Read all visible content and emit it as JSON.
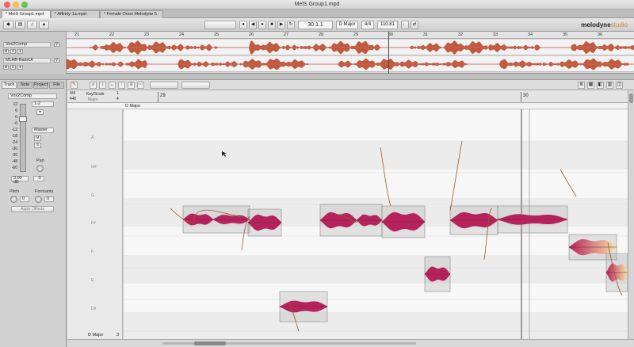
{
  "window": {
    "title": "MelS Group1.mpd",
    "controls": {
      "close_color": "#ed6a5e",
      "minimize_color": "#f5bf4f",
      "zoom_color": "#62c554"
    }
  },
  "tabs": [
    {
      "label": "* MelS Group1.mpd",
      "active": true
    },
    {
      "label": "* Affinity-1a.mpd",
      "active": false
    },
    {
      "label": "* Female Oooo Melodyne 5",
      "active": false
    }
  ],
  "transport": {
    "position": "30.1.1",
    "key": "D Major",
    "meter": "4/4",
    "tempo": "110.81"
  },
  "brand": {
    "name": "melodyne",
    "edition": "studio"
  },
  "overview": {
    "bars": [
      "21",
      "22",
      "23",
      "24",
      "25",
      "26",
      "27",
      "28",
      "29",
      "30",
      "31",
      "32",
      "33",
      "34",
      "35",
      "36"
    ],
    "tracks": [
      {
        "name": "Vox2Comp",
        "m": "M",
        "s": "S"
      },
      {
        "name": "MLAB-BassUt",
        "m": "M",
        "s": "S"
      }
    ]
  },
  "inspector": {
    "tabs": [
      "Track",
      "Note",
      "Project",
      "File"
    ],
    "track_name": "Vox2Comp",
    "input": "1-2",
    "output": "Master",
    "m": "M",
    "s": "S",
    "meter_scale": [
      "12",
      "6",
      "0",
      "-6",
      "-12",
      "-18",
      "-24",
      "-30",
      "-36",
      "-48",
      "-60"
    ],
    "pan_label": "Pan",
    "pan_value": "0",
    "volume_value": "0.00 dB",
    "pitch_label": "Pitch",
    "formants_label": "Formants",
    "pitch_value": "0",
    "formants_value": "0",
    "apply_label": "Apply Offsets"
  },
  "editor": {
    "ruler_bars": [
      {
        "label": "29"
      },
      {
        "label": "30"
      }
    ],
    "ruler_left": [
      "4/4",
      "440"
    ],
    "ruler_right": [
      "1",
      "4"
    ],
    "keyscale_header": "Key/Scale",
    "keyscale_sub": "Major",
    "key_label": "D Major",
    "bottom_key": "D Major",
    "bottom_num": "3",
    "pitch_rows": [
      "A",
      "G#",
      "G",
      "F#",
      "F",
      "E",
      "D#"
    ]
  },
  "colors": {
    "blob_dark": "#b6235c",
    "blob_light": "#f8e6a8",
    "row_shade": "#e9e9e9",
    "playhead": "#777777"
  }
}
